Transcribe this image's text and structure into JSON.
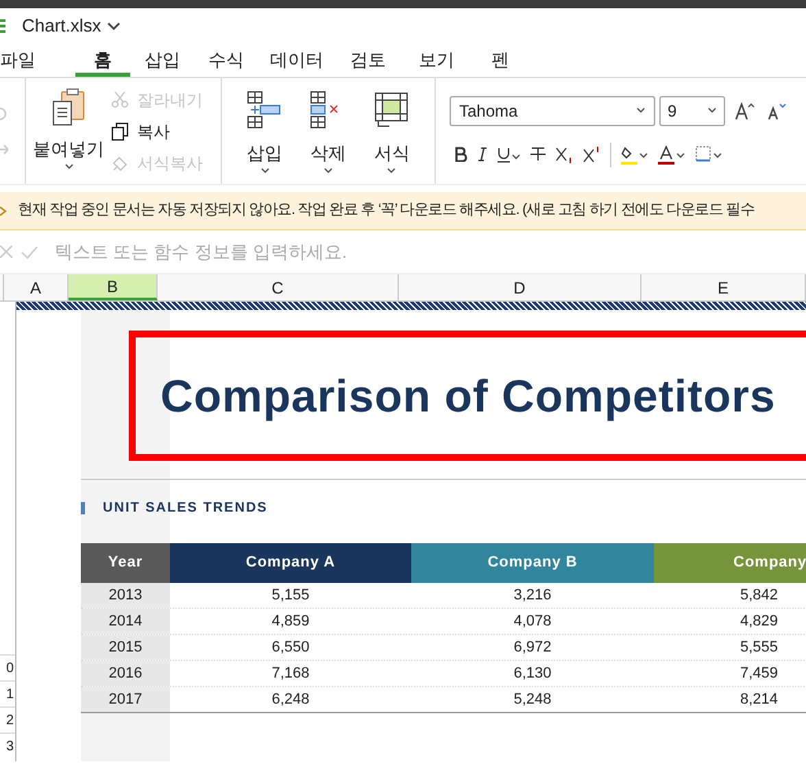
{
  "file": {
    "name": "Chart.xlsx"
  },
  "tabs": [
    {
      "label": "파일",
      "selected": false
    },
    {
      "label": "홈",
      "selected": true
    },
    {
      "label": "삽입",
      "selected": false
    },
    {
      "label": "수식",
      "selected": false
    },
    {
      "label": "데이터",
      "selected": false
    },
    {
      "label": "검토",
      "selected": false
    },
    {
      "label": "보기",
      "selected": false
    },
    {
      "label": "펜",
      "selected": false
    }
  ],
  "ribbon": {
    "paste": "붙여넣기",
    "clipboard": [
      {
        "label": "잘라내기",
        "kind": "cut",
        "disabled": true
      },
      {
        "label": "복사",
        "kind": "copy",
        "disabled": false
      },
      {
        "label": "서식복사",
        "kind": "format",
        "disabled": true
      }
    ],
    "cells": [
      {
        "label": "삽입",
        "kind": "insert"
      },
      {
        "label": "삭제",
        "kind": "delete"
      },
      {
        "label": "서식",
        "kind": "format"
      }
    ],
    "font": "Tahoma",
    "size": "9"
  },
  "notice": "현재 작업 중인 문서는 자동 저장되지 않아요. 작업 완료 후 ‘꼭’ 다운로드 해주세요. (새로 고침 하기 전에도 다운로드 필수",
  "formula_bar": {
    "placeholder": "텍스트 또는 함수 정보를 입력하세요."
  },
  "columns": [
    {
      "label": "A",
      "selected": false
    },
    {
      "label": "B",
      "selected": true
    },
    {
      "label": "C",
      "selected": false
    },
    {
      "label": "D",
      "selected": false
    },
    {
      "label": "E",
      "selected": false
    }
  ],
  "row_numbers": [
    "0",
    "1",
    "2",
    "3"
  ],
  "sheet": {
    "title": "Comparison of Competitors",
    "subtitle": "UNIT SALES TRENDS",
    "table": {
      "columns": [
        {
          "label": "Year",
          "color": "#595959"
        },
        {
          "label": "Company A",
          "color": "#1b365d"
        },
        {
          "label": "Company B",
          "color": "#31859c"
        },
        {
          "label": "Company",
          "color": "#77933c"
        }
      ],
      "rows": [
        [
          "2013",
          "5,155",
          "3,216",
          "5,842"
        ],
        [
          "2014",
          "4,859",
          "4,078",
          "4,829"
        ],
        [
          "2015",
          "6,550",
          "6,972",
          "5,555"
        ],
        [
          "2016",
          "7,168",
          "6,130",
          "7,459"
        ],
        [
          "2017",
          "6,248",
          "5,248",
          "8,214"
        ]
      ]
    }
  }
}
